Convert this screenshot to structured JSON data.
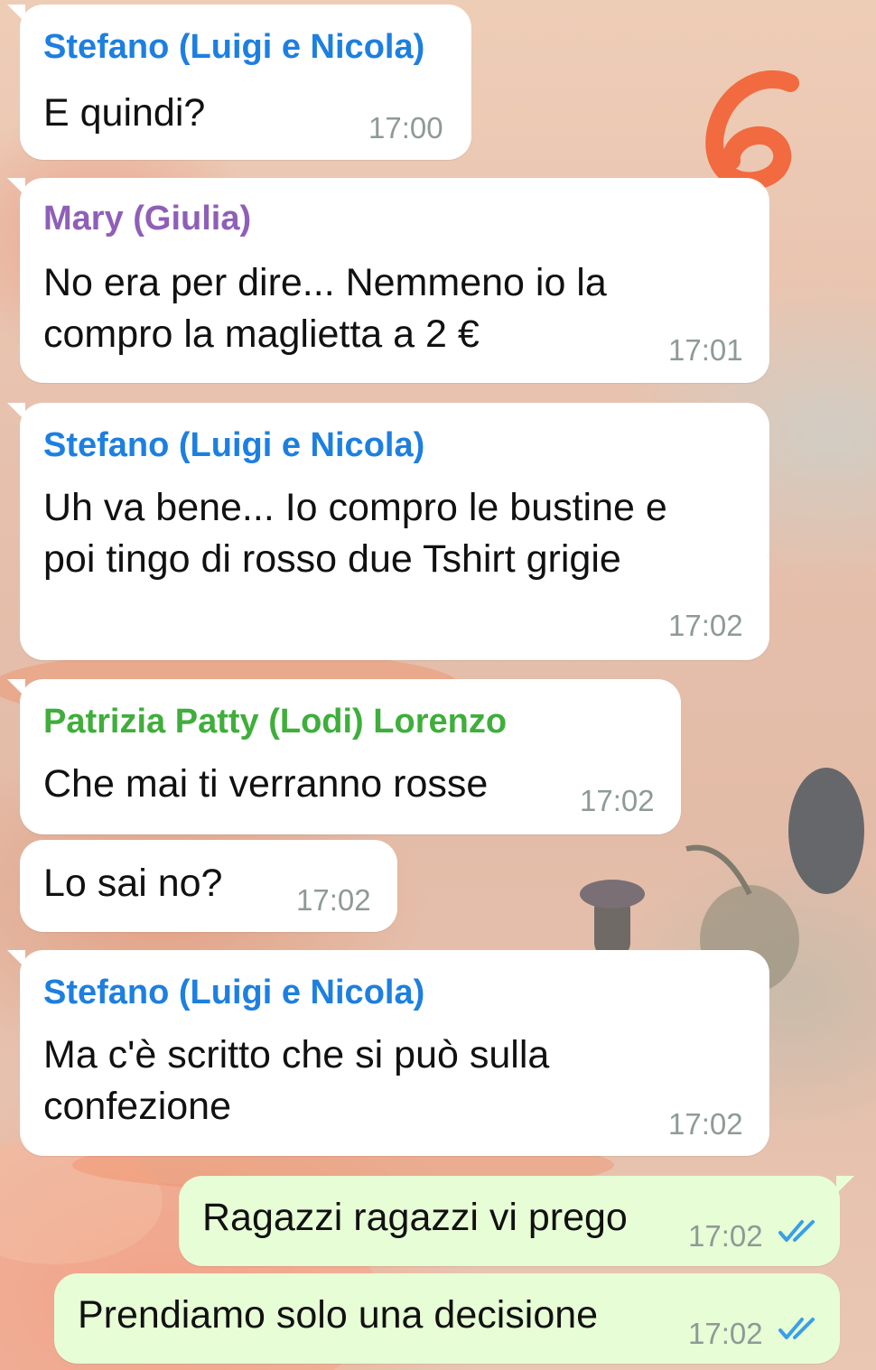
{
  "annotation": {
    "number": "6",
    "color": "#f26a3f"
  },
  "colors": {
    "sender_stefano": "#1d7fe0",
    "sender_mary": "#8f5fb8",
    "sender_patrizia": "#3fae3b",
    "read_ticks": "#3a9fe6",
    "outgoing_bubble": "#e7fdd6",
    "incoming_bubble": "#ffffff"
  },
  "messages": [
    {
      "sender": "Stefano (Luigi e Nicola)",
      "lines": [
        "E quindi?"
      ],
      "time": "17:00"
    },
    {
      "sender": "Mary (Giulia)",
      "lines": [
        "No era per dire... Nemmeno io la",
        "compro la maglietta a 2 €"
      ],
      "time": "17:01"
    },
    {
      "sender": "Stefano (Luigi e Nicola)",
      "lines": [
        "Uh va bene... Io compro le bustine e",
        "poi tingo di rosso due Tshirt grigie"
      ],
      "time": "17:02"
    },
    {
      "sender": "Patrizia Patty (Lodi) Lorenzo",
      "lines": [
        "Che mai ti verranno rosse"
      ],
      "time": "17:02"
    },
    {
      "lines": [
        "Lo sai no?"
      ],
      "time": "17:02"
    },
    {
      "sender": "Stefano (Luigi e Nicola)",
      "lines": [
        "Ma c'è scritto che si può sulla",
        "confezione"
      ],
      "time": "17:02"
    },
    {
      "outgoing": true,
      "lines": [
        "Ragazzi ragazzi vi prego"
      ],
      "time": "17:02",
      "status": "read-double-check-icon"
    },
    {
      "outgoing": true,
      "lines": [
        "Prendiamo solo una decisione"
      ],
      "time": "17:02",
      "status": "read-double-check-icon"
    }
  ]
}
